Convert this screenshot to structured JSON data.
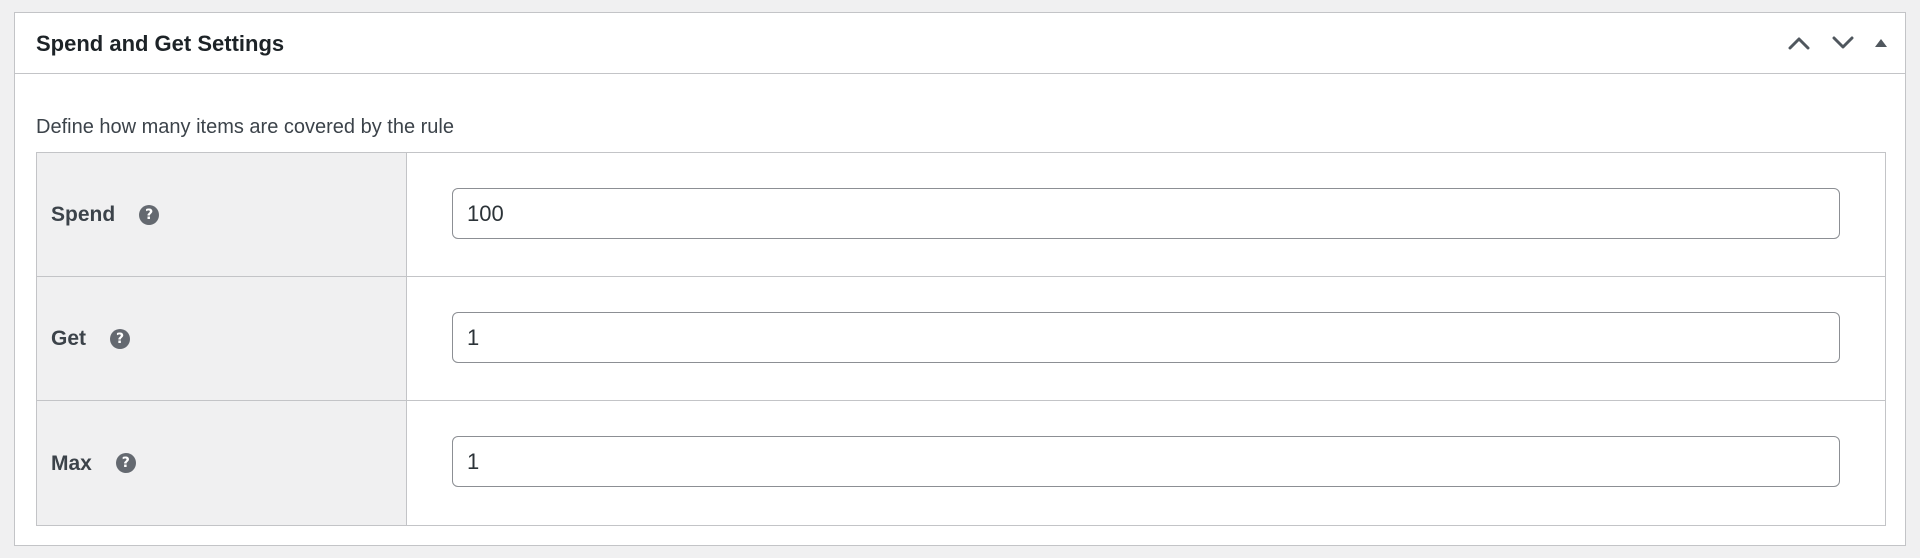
{
  "postbox": {
    "title": "Spend and Get Settings",
    "actions": {
      "move_up_icon": "chevron-up-icon",
      "move_down_icon": "chevron-down-icon",
      "toggle_icon": "triangle-up-icon"
    }
  },
  "description": "Define how many items are covered by the rule",
  "fields": [
    {
      "label": "Spend",
      "value": "100",
      "help_icon": "question-circle-icon"
    },
    {
      "label": "Get",
      "value": "1",
      "help_icon": "question-circle-icon"
    },
    {
      "label": "Max",
      "value": "1",
      "help_icon": "question-circle-icon"
    }
  ],
  "colors": {
    "background": "#f0f0f1",
    "panel": "#ffffff",
    "border": "#c3c4c7",
    "label_cell": "#f0f0f1",
    "input_border": "#8c8f94",
    "icon": "#646970"
  }
}
